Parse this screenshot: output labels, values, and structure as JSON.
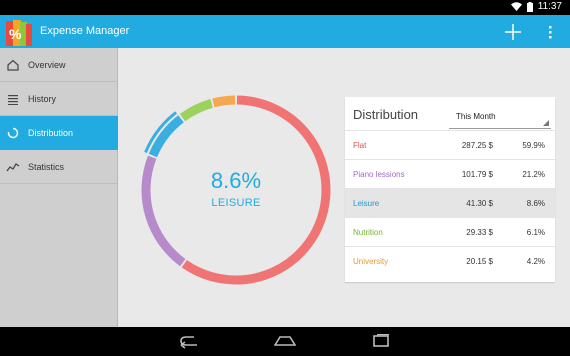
{
  "status": {
    "time": "11:37"
  },
  "app": {
    "title": "Expense Manager"
  },
  "sidebar": {
    "items": [
      {
        "label": "Overview"
      },
      {
        "label": "History"
      },
      {
        "label": "Distribution"
      },
      {
        "label": "Statistics"
      }
    ]
  },
  "chart": {
    "center_pct": "8.6%",
    "center_label": "LEISURE",
    "segments": [
      {
        "name": "Flat",
        "pct": 59.9,
        "color": "#f07474"
      },
      {
        "name": "Piano lessions",
        "pct": 21.2,
        "color": "#b78bcb"
      },
      {
        "name": "Leisure",
        "pct": 8.6,
        "color": "#3aaee0"
      },
      {
        "name": "Nutrition",
        "pct": 6.1,
        "color": "#9bd15c"
      },
      {
        "name": "University",
        "pct": 4.2,
        "color": "#f5a94e"
      }
    ]
  },
  "distribution": {
    "title": "Distribution",
    "period": "This Month",
    "rows": [
      {
        "name": "Flat",
        "amount": "287.25 $",
        "pct": "59.9%",
        "color": "#e05252"
      },
      {
        "name": "Piano lessions",
        "amount": "101.79 $",
        "pct": "21.2%",
        "color": "#a36cbd"
      },
      {
        "name": "Leisure",
        "amount": "41.30 $",
        "pct": "8.6%",
        "color": "#1e9bd0"
      },
      {
        "name": "Nutrition",
        "amount": "29.33 $",
        "pct": "6.1%",
        "color": "#76b52e"
      },
      {
        "name": "University",
        "amount": "20.15 $",
        "pct": "4.2%",
        "color": "#e89a2f"
      }
    ]
  }
}
